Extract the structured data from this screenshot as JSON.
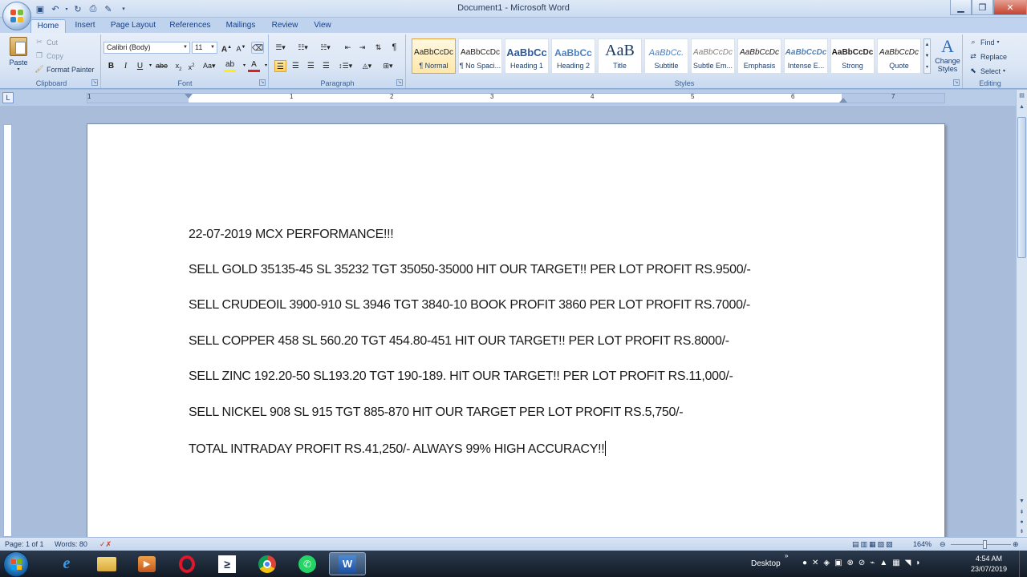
{
  "window": {
    "title": "Document1 - Microsoft Word"
  },
  "tabs": [
    "Home",
    "Insert",
    "Page Layout",
    "References",
    "Mailings",
    "Review",
    "View"
  ],
  "ribbon": {
    "clipboard": {
      "label": "Clipboard",
      "paste": "Paste",
      "cut": "Cut",
      "copy": "Copy",
      "format_painter": "Format Painter"
    },
    "font": {
      "label": "Font",
      "font_name": "Calibri (Body)",
      "font_size": "11"
    },
    "paragraph": {
      "label": "Paragraph"
    },
    "styles": {
      "label": "Styles",
      "items": [
        {
          "sample": "AaBbCcDc",
          "name": "¶ Normal"
        },
        {
          "sample": "AaBbCcDc",
          "name": "¶ No Spaci..."
        },
        {
          "sample": "AaBbCc",
          "name": "Heading 1"
        },
        {
          "sample": "AaBbCc",
          "name": "Heading 2"
        },
        {
          "sample": "AaB",
          "name": "Title"
        },
        {
          "sample": "AaBbCc.",
          "name": "Subtitle"
        },
        {
          "sample": "AaBbCcDc",
          "name": "Subtle Em..."
        },
        {
          "sample": "AaBbCcDc",
          "name": "Emphasis"
        },
        {
          "sample": "AaBbCcDc",
          "name": "Intense E..."
        },
        {
          "sample": "AaBbCcDc",
          "name": "Strong"
        },
        {
          "sample": "AaBbCcDc",
          "name": "Quote"
        }
      ],
      "change_styles": "Change Styles"
    },
    "editing": {
      "label": "Editing",
      "find": "Find",
      "replace": "Replace",
      "select": "Select"
    }
  },
  "ruler": {
    "numbers": [
      "1",
      "1",
      "2",
      "3",
      "4",
      "5",
      "6",
      "7"
    ]
  },
  "document": {
    "lines": [
      "22-07-2019 MCX PERFORMANCE!!!",
      "SELL GOLD 35135-45  SL 35232 TGT 35050-35000 HIT OUR TARGET!! PER LOT PROFIT RS.9500/-",
      "SELL CRUDEOIL 3900-910 SL 3946 TGT 3840-10 BOOK PROFIT 3860 PER LOT PROFIT RS.7000/-",
      "SELL COPPER 458 SL 560.20 TGT 454.80-451 HIT OUR TARGET!! PER LOT PROFIT RS.8000/-",
      "SELL ZINC 192.20-50 SL193.20 TGT 190-189. HIT OUR TARGET!! PER LOT PROFIT RS.11,000/-",
      "SELL NICKEL 908 SL 915 TGT 885-870 HIT OUR TARGET PER LOT PROFIT RS.5,750/-",
      "TOTAL INTRADAY PROFIT RS.41,250/- ALWAYS 99% HIGH ACCURACY!!"
    ]
  },
  "status": {
    "page": "Page: 1 of 1",
    "words": "Words: 80",
    "zoom": "164%"
  },
  "taskbar": {
    "desktop": "Desktop",
    "time": "4:54 AM",
    "date": "23/07/2019"
  }
}
